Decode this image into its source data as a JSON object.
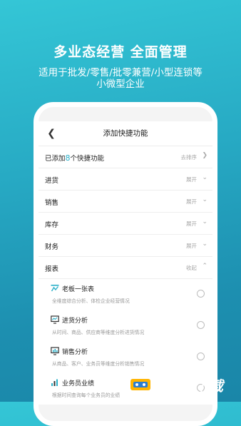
{
  "hero": {
    "headline": "多业态经营 全面管理",
    "subline1": "适用于批发/零售/批零兼营/小型连锁等",
    "subline2": "小微型企业"
  },
  "nav": {
    "back_icon": "chevron-left-icon",
    "title": "添加快捷功能"
  },
  "summary": {
    "prefix": "已添加",
    "count": "8",
    "suffix": "个快捷功能",
    "action": "去排序"
  },
  "sections": [
    {
      "label": "进货",
      "action": "展开"
    },
    {
      "label": "销售",
      "action": "展开"
    },
    {
      "label": "库存",
      "action": "展开"
    },
    {
      "label": "财务",
      "action": "展开"
    },
    {
      "label": "报表",
      "action": "收起"
    }
  ],
  "report_items": [
    {
      "title": "老板一张表",
      "desc": "全维度综合分析、体检企业经营情况",
      "icon": "report-chart-icon"
    },
    {
      "title": "进货分析",
      "desc": "从时间、商品、供应商等维度分析进货情况",
      "icon": "purchase-analysis-icon"
    },
    {
      "title": "销售分析",
      "desc": "从商品、客户、业务员等维度分析销售情况",
      "icon": "sales-analysis-icon"
    },
    {
      "title": "业务员业绩",
      "desc": "根据时间查询每个业务员的业绩",
      "icon": "bar-chart-icon"
    }
  ],
  "watermark": {
    "text": "80后下载"
  },
  "colors": {
    "accent": "#2bb0c9",
    "background_top": "#34c6d6",
    "background_bottom": "#1a86a8"
  }
}
